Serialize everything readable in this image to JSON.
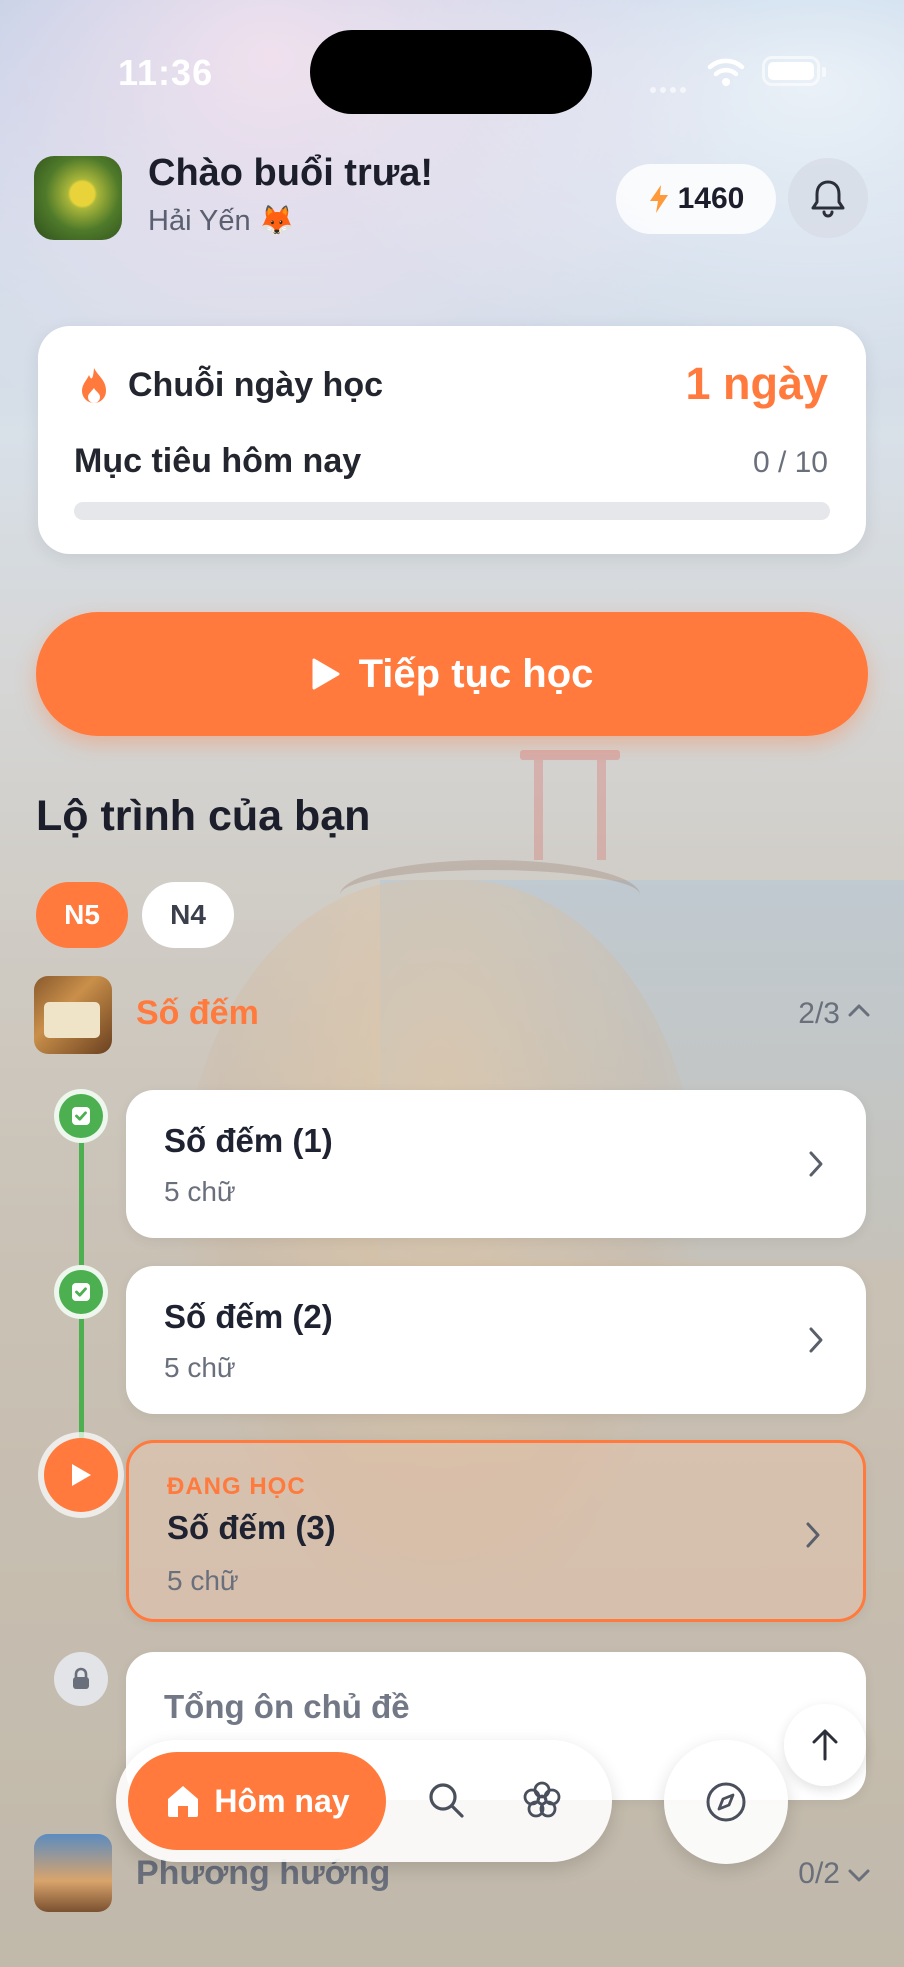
{
  "status_bar": {
    "time": "11:36"
  },
  "header": {
    "greeting": "Chào buổi trưa!",
    "username": "Hải Yến 🦊",
    "points": "1460"
  },
  "streak_card": {
    "streak_label": "Chuỗi ngày học",
    "streak_value": "1 ngày",
    "goal_label": "Mục tiêu hôm nay",
    "goal_value": "0 / 10",
    "goal_progress": 0
  },
  "cta": {
    "label": "Tiếp tục học"
  },
  "roadmap": {
    "title": "Lộ trình của bạn",
    "levels": [
      {
        "label": "N5",
        "active": true
      },
      {
        "label": "N4",
        "active": false
      }
    ],
    "topics": [
      {
        "name": "Số đếm",
        "count": "2/3",
        "expanded": true,
        "lessons": [
          {
            "title": "Số đếm (1)",
            "sub": "5 chữ",
            "state": "done"
          },
          {
            "title": "Số đếm (2)",
            "sub": "5 chữ",
            "state": "done"
          },
          {
            "tag": "ĐANG HỌC",
            "title": "Số đếm (3)",
            "sub": "5 chữ",
            "state": "current"
          },
          {
            "title": "Tổng ôn chủ đề",
            "state": "locked"
          }
        ]
      },
      {
        "name": "Phương hướng",
        "count": "0/2",
        "expanded": false
      }
    ]
  },
  "tabbar": {
    "home_label": "Hôm nay"
  },
  "colors": {
    "accent": "#ff7a3c",
    "done": "#4caf50"
  }
}
